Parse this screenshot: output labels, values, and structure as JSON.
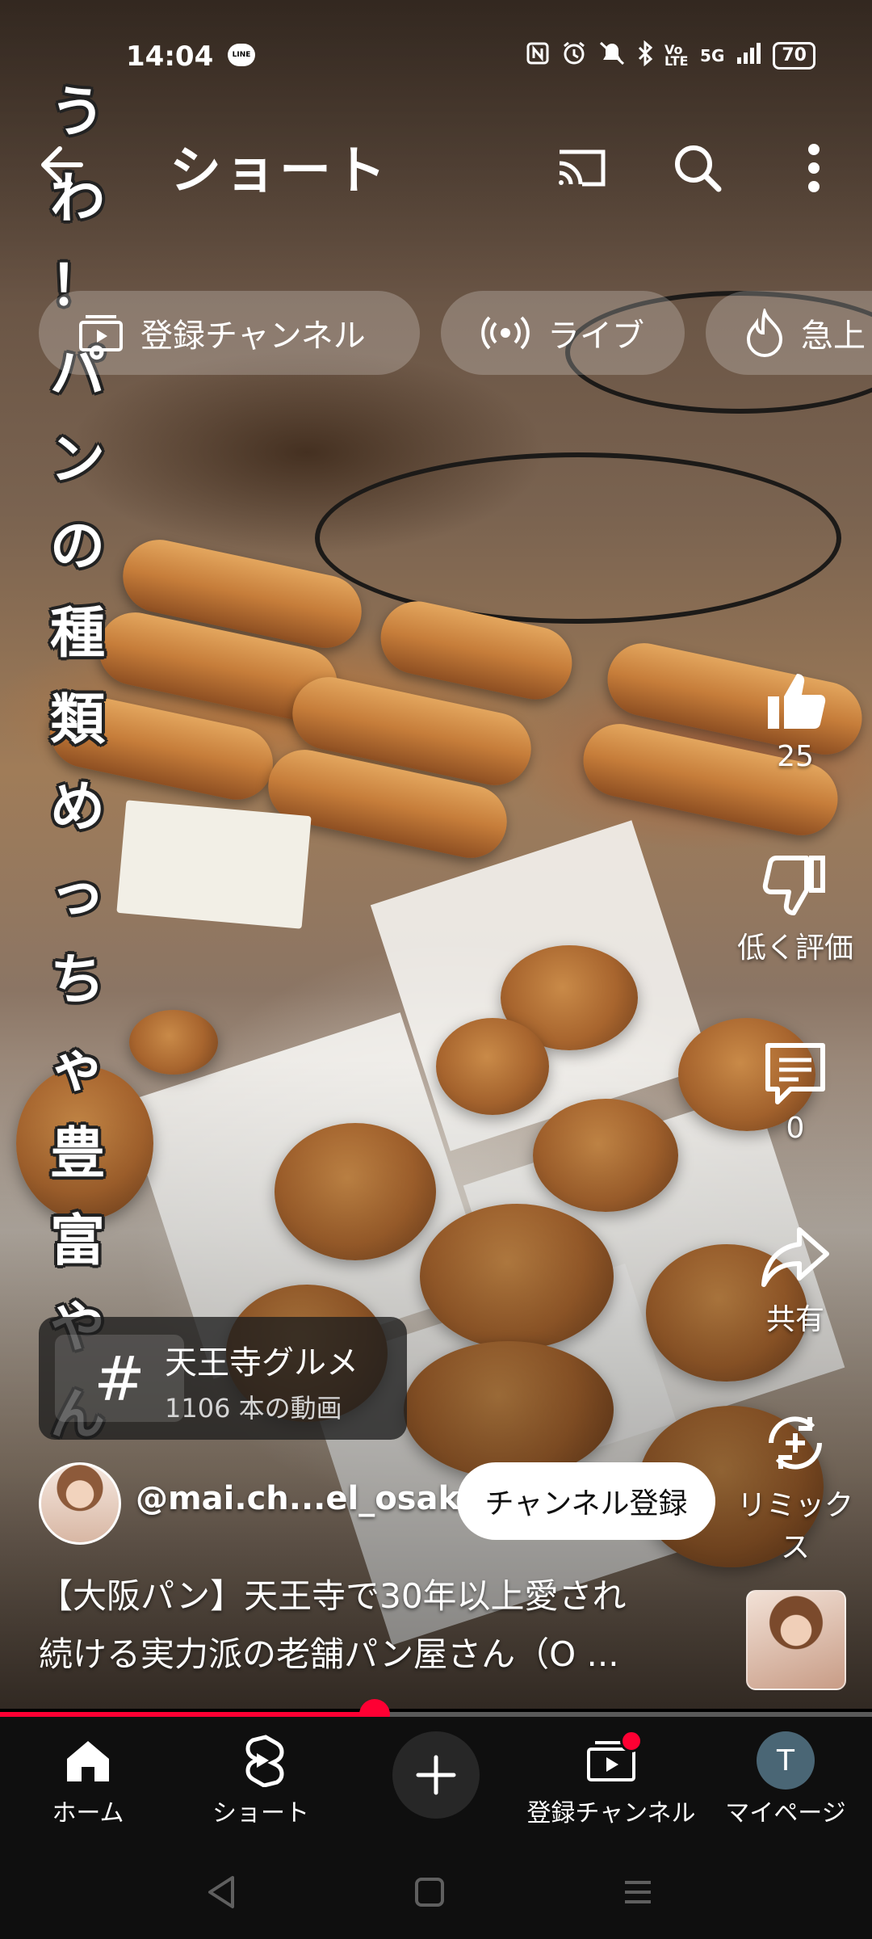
{
  "status_bar": {
    "time": "14:04",
    "line_badge": "LINE",
    "network": "5G",
    "volte": "Vo LTE",
    "battery": "70"
  },
  "header": {
    "title": "ショート",
    "icons": [
      "back-arrow-icon",
      "cast-icon",
      "search-icon",
      "more-vertical-icon"
    ]
  },
  "chips": [
    {
      "label": "登録チャンネル",
      "icon": "subscriptions-icon"
    },
    {
      "label": "ライブ",
      "icon": "live-icon"
    },
    {
      "label": "急上",
      "icon": "trending-icon"
    }
  ],
  "vertical_caption": "うわ！パンの種類めっちゃ豊富やん！",
  "actions": {
    "like_count": "25",
    "dislike_label": "低く評価",
    "comment_count": "0",
    "share_label": "共有",
    "remix_label": "リミックス"
  },
  "hashtag": {
    "symbol": "#",
    "title": "天王寺グルメ",
    "subtitle": "1106 本の動画"
  },
  "channel": {
    "handle": "@mai.ch...el_osaka",
    "subscribe_label": "チャンネル登録"
  },
  "description": {
    "line1": "【大阪パン】天王寺で30年以上愛され",
    "line2": "続ける実力派の老舗パン屋さん（O ..."
  },
  "progress": {
    "fraction": 0.43
  },
  "bottom_nav": {
    "home": "ホーム",
    "shorts": "ショート",
    "subscriptions": "登録チャンネル",
    "mypage": "マイページ",
    "mypage_initial": "T"
  },
  "colors": {
    "accent": "#ff0033",
    "nav_bg": "#0f0f0f",
    "chip_bg": "rgba(255,255,255,0.22)"
  }
}
